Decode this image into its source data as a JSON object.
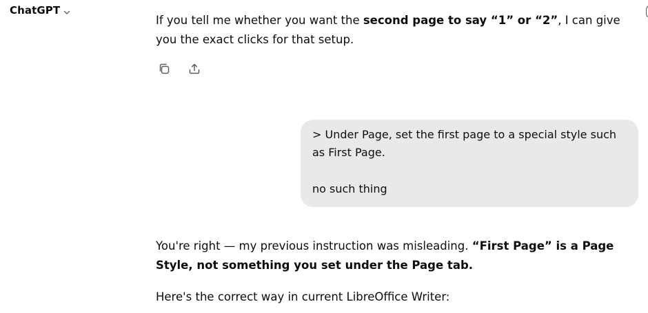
{
  "header": {
    "app_title": "ChatGPT",
    "model_chevron_icon": "chevron-down-icon"
  },
  "conversation": {
    "cut_off_fragment": "",
    "assistant_msg_1": {
      "part1": "If you tell me whether you want the ",
      "bold1": "second page to say “1” or “2”",
      "part2": ", I can give you the exact clicks for that setup."
    },
    "actions": {
      "copy_icon": "copy-icon",
      "share_icon": "share-icon"
    },
    "user_msg": {
      "quote_line": "> Under Page, set the first page to a special style such as First Page.",
      "reply_line": "no such thing"
    },
    "assistant_msg_2": {
      "part1": "You're right — my previous instruction was misleading. ",
      "bold1": "“First Page” is a Page Style, not something you set under the Page tab.",
      "para2": "Here's the correct way in current LibreOffice Writer:"
    }
  }
}
